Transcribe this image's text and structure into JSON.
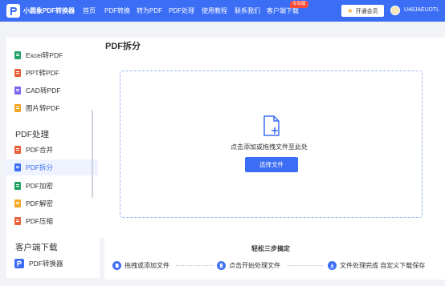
{
  "header": {
    "brand": "小圆象PDF转换器",
    "nav": [
      "首页",
      "PDF转换",
      "转为PDF",
      "PDF处理",
      "使用教程",
      "联系我们",
      "客户端下载"
    ],
    "badge": "专业版",
    "vip_label": "开通会员",
    "username": "U48JAEUDTL"
  },
  "sidebar": {
    "convert_items": [
      {
        "label": "Excel转PDF",
        "icon": "excel-file-icon",
        "color": "#21a366"
      },
      {
        "label": "PPT转PDF",
        "icon": "ppt-file-icon",
        "color": "#e8613c"
      },
      {
        "label": "CAD转PDF",
        "icon": "cad-file-icon",
        "color": "#7b68ee"
      },
      {
        "label": "图片转PDF",
        "icon": "image-file-icon",
        "color": "#f5a623"
      }
    ],
    "section_process": "PDF处理",
    "process_items": [
      {
        "label": "PDF合并",
        "icon": "merge-file-icon",
        "color": "#e8613c"
      },
      {
        "label": "PDF拆分",
        "icon": "split-file-icon",
        "color": "#3c6ef5",
        "active": true
      },
      {
        "label": "PDF加密",
        "icon": "encrypt-file-icon",
        "color": "#21a366"
      },
      {
        "label": "PDF解密",
        "icon": "decrypt-file-icon",
        "color": "#f5a623"
      },
      {
        "label": "PDF压缩",
        "icon": "compress-file-icon",
        "color": "#e8613c"
      }
    ],
    "section_download": "客户端下载",
    "app_item": {
      "label": "PDF转换器",
      "icon": "pdf-app-icon"
    }
  },
  "main": {
    "title": "PDF拆分",
    "drop_text": "点击添加或拖拽文件至此处",
    "select_button": "选择文件"
  },
  "steps": {
    "title": "轻松三步搞定",
    "items": [
      {
        "label": "拖拽或添加文件",
        "icon": "upload-file-icon"
      },
      {
        "label": "点击开始处理文件",
        "icon": "start-process-icon"
      },
      {
        "label": "文件处理完成 自定义下载保存",
        "icon": "download-icon"
      }
    ]
  },
  "colors": {
    "accent": "#3c6ef5",
    "badge": "#ff4d3a"
  }
}
